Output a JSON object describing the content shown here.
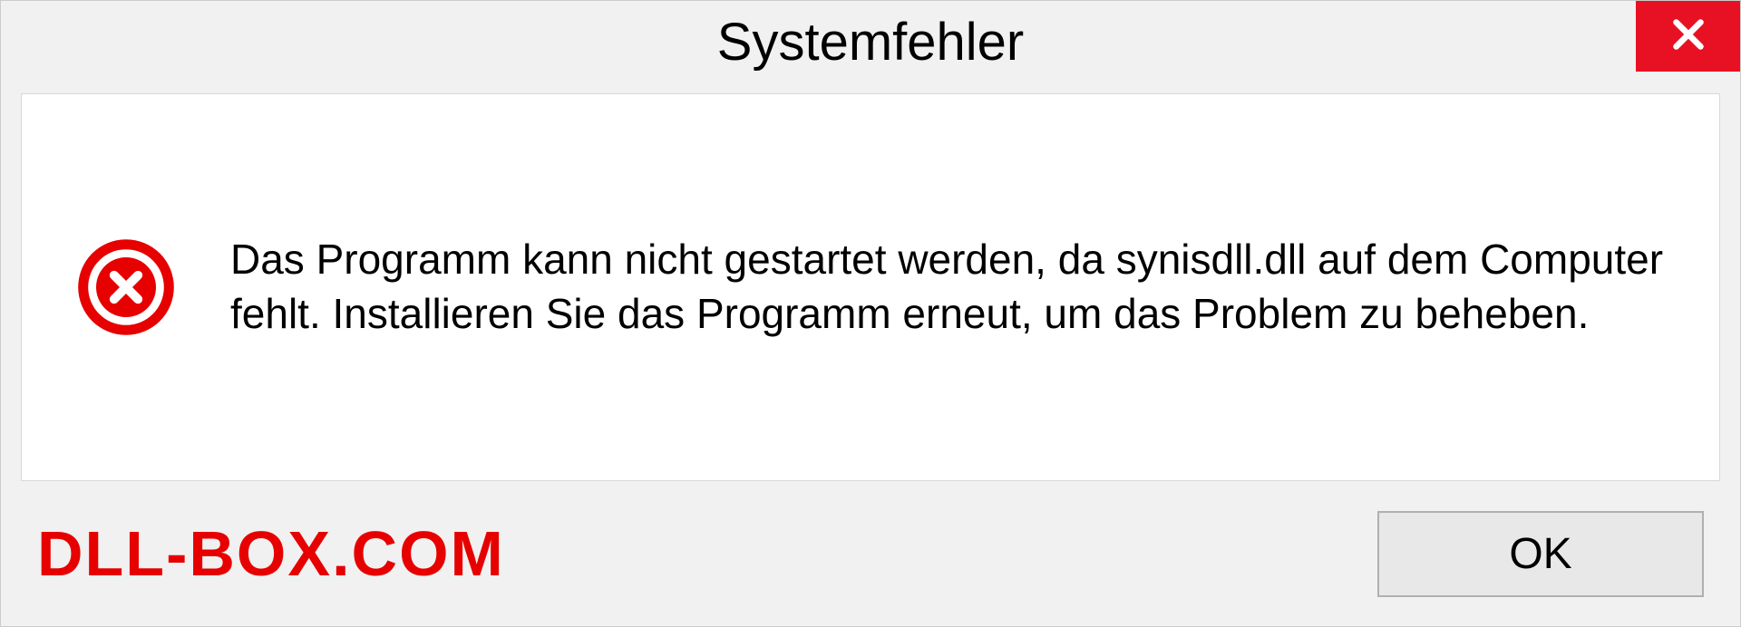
{
  "dialog": {
    "title": "Systemfehler",
    "message": "Das Programm kann nicht gestartet werden, da synisdll.dll auf dem Computer fehlt. Installieren Sie das Programm erneut, um das Problem zu beheben.",
    "ok_label": "OK"
  },
  "watermark": "DLL-BOX.COM"
}
